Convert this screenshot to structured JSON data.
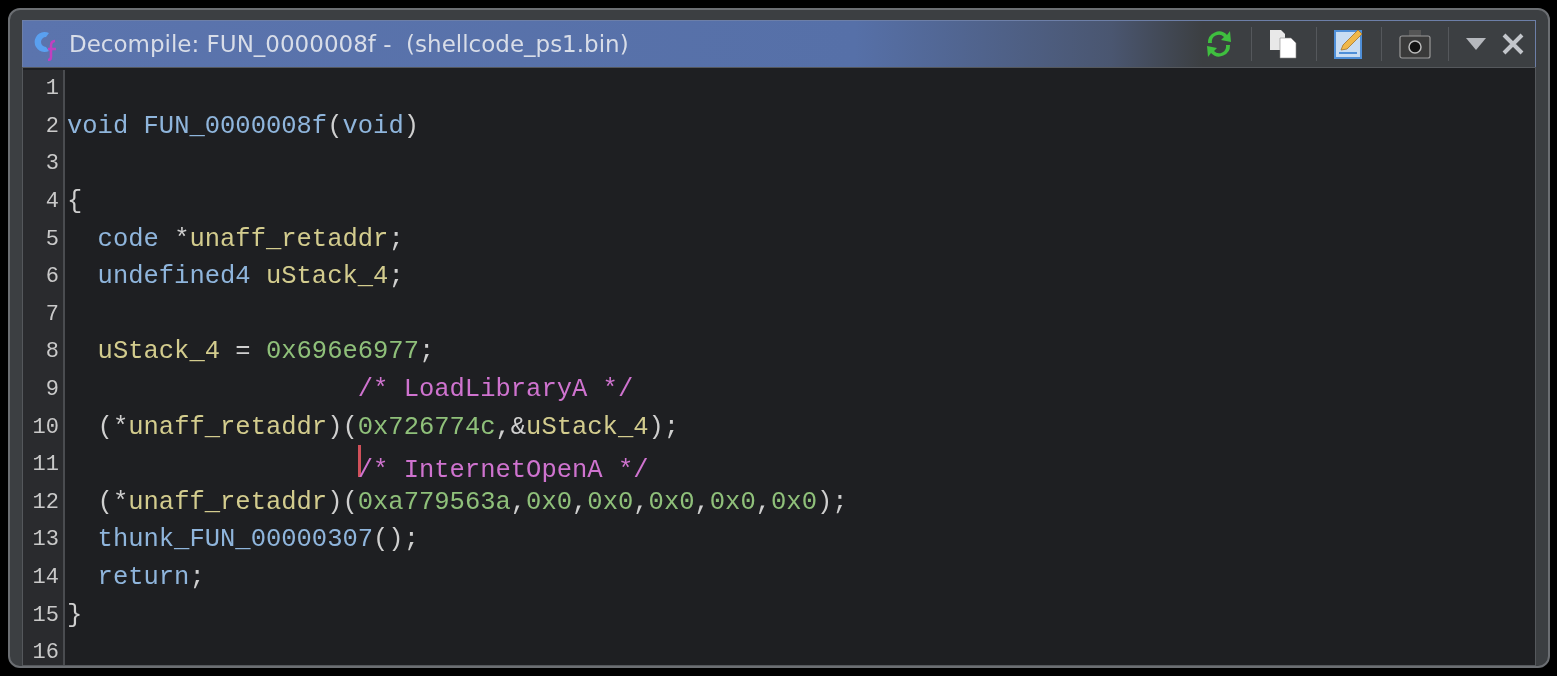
{
  "window": {
    "title": "Decompile: FUN_0000008f -  (shellcode_ps1.bin)"
  },
  "lines": [
    {
      "number": "1",
      "cursor": false
    },
    {
      "number": "2",
      "cursor": false,
      "tokens": [
        {
          "text": "void",
          "kind": "type"
        },
        {
          "text": " FUN_0000008f",
          "kind": "function"
        },
        {
          "text": "(",
          "kind": "plain"
        },
        {
          "text": "void",
          "kind": "type"
        },
        {
          "text": ")",
          "kind": "plain"
        }
      ]
    },
    {
      "number": "3",
      "cursor": false
    },
    {
      "number": "4",
      "cursor": false,
      "tokens": [
        {
          "text": "{",
          "kind": "plain"
        }
      ]
    },
    {
      "number": "5",
      "cursor": false,
      "tokens": [
        {
          "text": "  code",
          "kind": "type"
        },
        {
          "text": " *",
          "kind": "plain"
        },
        {
          "text": "unaff_retaddr",
          "kind": "variable"
        },
        {
          "text": ";",
          "kind": "plain"
        }
      ]
    },
    {
      "number": "6",
      "cursor": false,
      "tokens": [
        {
          "text": "  undefined4",
          "kind": "type"
        },
        {
          "text": " uStack_4",
          "kind": "variable"
        },
        {
          "text": ";",
          "kind": "plain"
        }
      ]
    },
    {
      "number": "7",
      "cursor": false
    },
    {
      "number": "8",
      "cursor": false,
      "tokens": [
        {
          "text": "  uStack_4",
          "kind": "variable"
        },
        {
          "text": " = ",
          "kind": "plain"
        },
        {
          "text": "0x696e6977",
          "kind": "number"
        },
        {
          "text": ";",
          "kind": "plain"
        }
      ]
    },
    {
      "number": "9",
      "cursor": false,
      "tokens": [
        {
          "text": "                   /* LoadLibraryA */",
          "kind": "comment"
        }
      ]
    },
    {
      "number": "10",
      "cursor": false,
      "tokens": [
        {
          "text": "  (*",
          "kind": "plain"
        },
        {
          "text": "unaff_retaddr",
          "kind": "variable"
        },
        {
          "text": ")(",
          "kind": "plain"
        },
        {
          "text": "0x726774c",
          "kind": "number"
        },
        {
          "text": ",&",
          "kind": "plain"
        },
        {
          "text": "uStack_4",
          "kind": "variable"
        },
        {
          "text": ");",
          "kind": "plain"
        }
      ]
    },
    {
      "number": "11",
      "cursor": true,
      "tokens": [
        {
          "text": "                   /* InternetOpenA */",
          "kind": "comment"
        }
      ]
    },
    {
      "number": "12",
      "cursor": false,
      "tokens": [
        {
          "text": "  (*",
          "kind": "plain"
        },
        {
          "text": "unaff_retaddr",
          "kind": "variable"
        },
        {
          "text": ")(",
          "kind": "plain"
        },
        {
          "text": "0xa779563a",
          "kind": "number"
        },
        {
          "text": ",",
          "kind": "plain"
        },
        {
          "text": "0x0",
          "kind": "number"
        },
        {
          "text": ",",
          "kind": "plain"
        },
        {
          "text": "0x0",
          "kind": "number"
        },
        {
          "text": ",",
          "kind": "plain"
        },
        {
          "text": "0x0",
          "kind": "number"
        },
        {
          "text": ",",
          "kind": "plain"
        },
        {
          "text": "0x0",
          "kind": "number"
        },
        {
          "text": ",",
          "kind": "plain"
        },
        {
          "text": "0x0",
          "kind": "number"
        },
        {
          "text": ");",
          "kind": "plain"
        }
      ]
    },
    {
      "number": "13",
      "cursor": false,
      "tokens": [
        {
          "text": "  thunk_FUN_00000307",
          "kind": "function"
        },
        {
          "text": "();",
          "kind": "plain"
        }
      ]
    },
    {
      "number": "14",
      "cursor": false,
      "tokens": [
        {
          "text": "  return",
          "kind": "type"
        },
        {
          "text": ";",
          "kind": "plain"
        }
      ]
    },
    {
      "number": "15",
      "cursor": false,
      "tokens": [
        {
          "text": "}",
          "kind": "plain"
        }
      ]
    },
    {
      "number": "16",
      "cursor": false
    }
  ]
}
